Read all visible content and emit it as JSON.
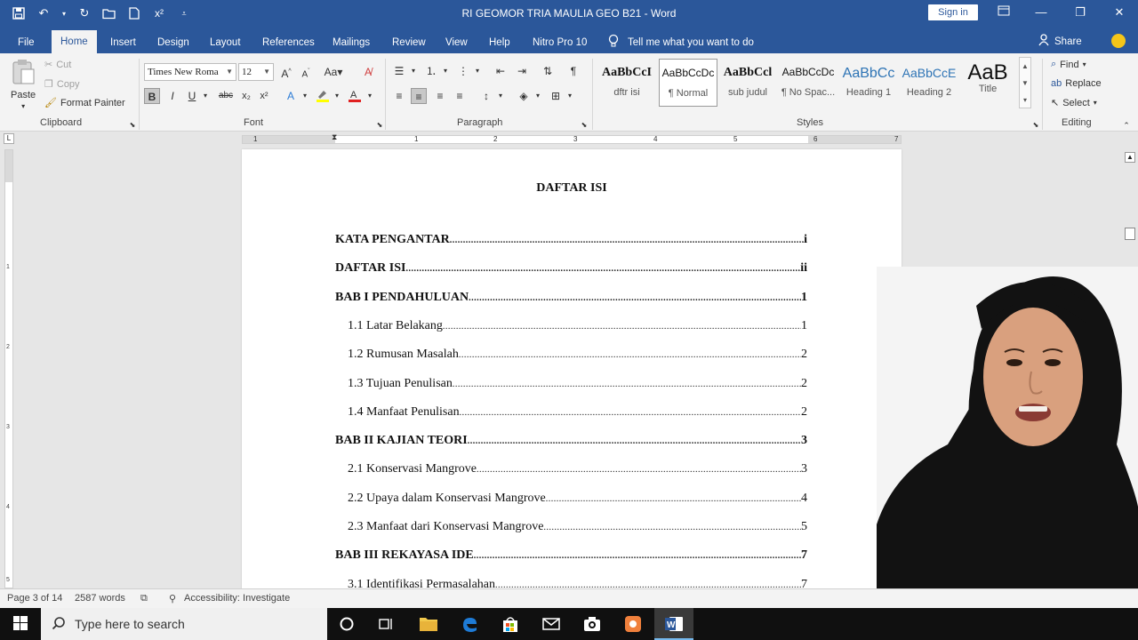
{
  "window": {
    "title": "RI GEOMOR TRIA MAULIA GEO B21  -  Word",
    "sign_in": "Sign in"
  },
  "tabs": [
    {
      "label": "File"
    },
    {
      "label": "Home"
    },
    {
      "label": "Insert"
    },
    {
      "label": "Design"
    },
    {
      "label": "Layout"
    },
    {
      "label": "References"
    },
    {
      "label": "Mailings"
    },
    {
      "label": "Review"
    },
    {
      "label": "View"
    },
    {
      "label": "Help"
    },
    {
      "label": "Nitro Pro 10"
    }
  ],
  "tell_me": "Tell me what you want to do",
  "share": "Share",
  "clipboard": {
    "paste": "Paste",
    "cut": "Cut",
    "copy": "Copy",
    "format_painter": "Format Painter",
    "group": "Clipboard"
  },
  "font": {
    "name": "Times New Roma",
    "size": "12",
    "group": "Font"
  },
  "paragraph": {
    "group": "Paragraph"
  },
  "styles": {
    "group": "Styles",
    "items": [
      {
        "sample": "AaBbCcI",
        "name": "dftr isi"
      },
      {
        "sample": "AaBbCcDc",
        "name": "¶ Normal"
      },
      {
        "sample": "AaBbCcl",
        "name": "sub judul"
      },
      {
        "sample": "AaBbCcDc",
        "name": "¶ No Spac..."
      },
      {
        "sample": "AaBbCc",
        "name": "Heading 1"
      },
      {
        "sample": "AaBbCcE",
        "name": "Heading 2"
      },
      {
        "sample": "AaB",
        "name": "Title"
      }
    ]
  },
  "editing": {
    "find": "Find",
    "replace": "Replace",
    "select": "Select",
    "group": "Editing"
  },
  "ruler": {
    "h_numbers": [
      "1",
      "1",
      "2",
      "3",
      "4",
      "5",
      "6",
      "7"
    ],
    "v_numbers": [
      "1",
      "2",
      "3",
      "4",
      "5"
    ]
  },
  "document": {
    "heading": "DAFTAR ISI",
    "toc": [
      {
        "label": "KATA PENGANTAR",
        "page": "i",
        "bold": true,
        "level": 0
      },
      {
        "label": "DAFTAR ISI",
        "page": "ii",
        "bold": true,
        "level": 0
      },
      {
        "label": "BAB I PENDAHULUAN ",
        "page": "1",
        "bold": true,
        "level": 0
      },
      {
        "label": "1.1 Latar Belakang",
        "page": "1",
        "bold": false,
        "level": 1
      },
      {
        "label": "1.2 Rumusan Masalah ",
        "page": "2",
        "bold": false,
        "level": 1
      },
      {
        "label": "1.3 Tujuan Penulisan ",
        "page": "2",
        "bold": false,
        "level": 1
      },
      {
        "label": "1.4 Manfaat Penulisan ",
        "page": "2",
        "bold": false,
        "level": 1
      },
      {
        "label": "BAB II KAJIAN TEORI ",
        "page": "3",
        "bold": true,
        "level": 0
      },
      {
        "label": "2.1 Konservasi Mangrove",
        "page": "3",
        "bold": false,
        "level": 1
      },
      {
        "label": "2.2 Upaya dalam Konservasi Mangrove ",
        "page": "4",
        "bold": false,
        "level": 1
      },
      {
        "label": "2.3 Manfaat dari Konservasi Mangrove ",
        "page": "5",
        "bold": false,
        "level": 1
      },
      {
        "label": "BAB III REKAYASA IDE ",
        "page": "7",
        "bold": true,
        "level": 0
      },
      {
        "label": "3.1 Identifikasi Permasalahan",
        "page": "7",
        "bold": false,
        "level": 1
      }
    ]
  },
  "status": {
    "page": "Page 3 of 14",
    "words": "2587 words",
    "accessibility": "Accessibility: Investigate"
  },
  "taskbar": {
    "search_placeholder": "Type here to search"
  },
  "colors": {
    "word_blue": "#2b579a",
    "ribbon_bg": "#f3f3f3",
    "taskbar_bg": "#101010"
  }
}
